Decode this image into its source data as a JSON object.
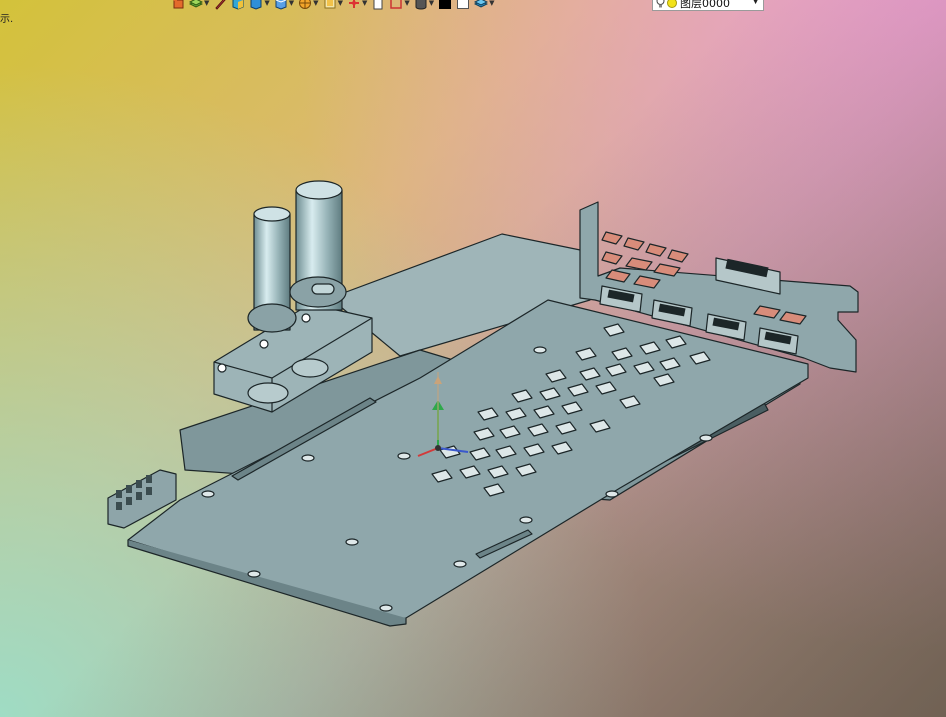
{
  "corner_text": "示.",
  "toolbar": {
    "items": [
      {
        "name": "undo-icon"
      },
      {
        "name": "layers-stack-icon"
      },
      {
        "name": "pencil-icon"
      },
      {
        "name": "solid-box-icon"
      },
      {
        "name": "box-view-icon"
      },
      {
        "name": "display-mode-icon"
      },
      {
        "name": "render-sphere-icon"
      },
      {
        "name": "view-orientation-icon"
      },
      {
        "name": "axis-triad-icon"
      },
      {
        "name": "clipboard-icon"
      },
      {
        "name": "section-frame-icon"
      },
      {
        "name": "cylinder-icon"
      },
      {
        "name": "color-black-icon"
      },
      {
        "name": "white-square-icon"
      },
      {
        "name": "layers-icon"
      }
    ],
    "layer_value": "图层0000"
  },
  "colors": {
    "model_fill": "#8fa7ab",
    "model_edge": "#1c2628",
    "accent_x": "#d23a3a",
    "accent_y": "#2ea84a",
    "accent_z": "#3a58cc"
  }
}
